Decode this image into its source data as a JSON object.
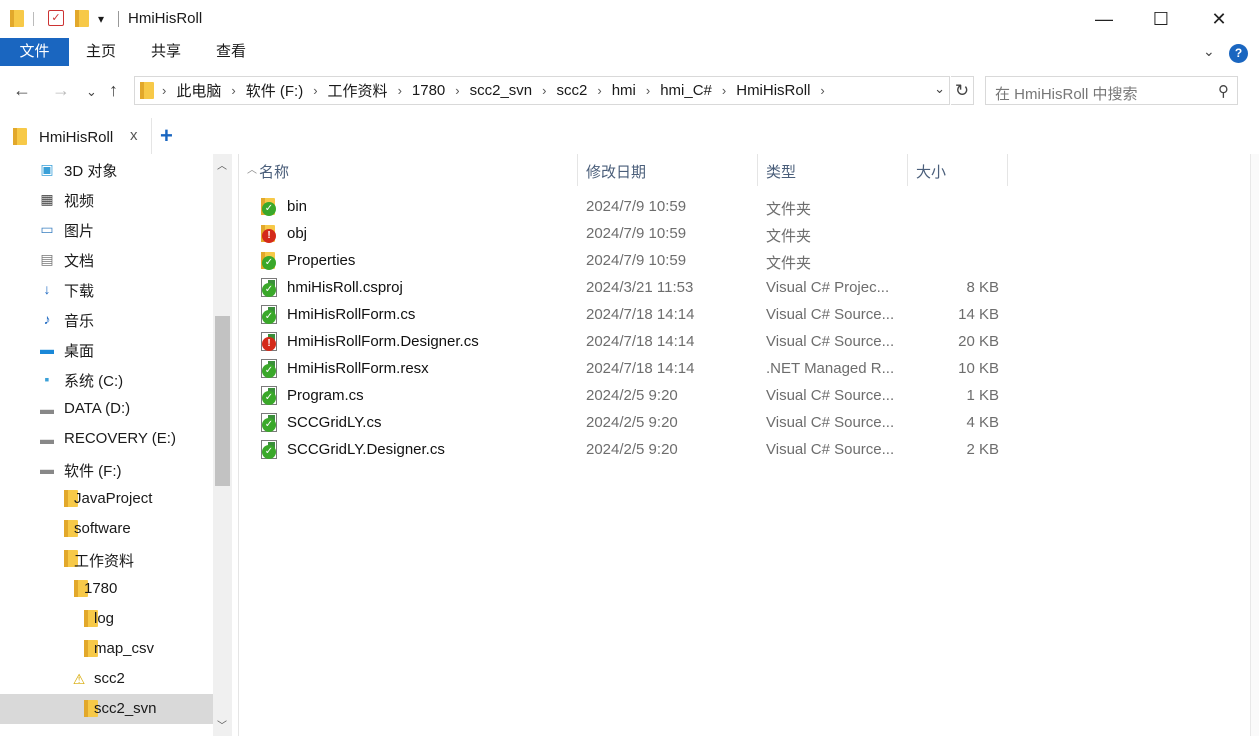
{
  "window": {
    "title": "HmiHisRoll",
    "minimize": "—",
    "maximize": "☐",
    "close": "✕"
  },
  "quick_access": {
    "dropdown": "▾"
  },
  "ribbon": {
    "tabs": [
      "文件",
      "主页",
      "共享",
      "查看"
    ],
    "expand": "⌄",
    "help": "?"
  },
  "nav": {
    "back": "←",
    "forward": "→",
    "recent": "⌄",
    "up": "↑",
    "breadcrumbs": [
      "此电脑",
      "软件 (F:)",
      "工作资料",
      "1780",
      "scc2_svn",
      "scc2",
      "hmi",
      "hmi_C#",
      "HmiHisRoll"
    ],
    "crumb_separator": "›",
    "dropdown": "⌄",
    "refresh": "↻"
  },
  "search": {
    "placeholder": "在 HmiHisRoll 中搜索",
    "icon": "⚲"
  },
  "tabs": {
    "current": "HmiHisRoll",
    "close": "x",
    "add": "+"
  },
  "sidebar": {
    "items": [
      {
        "label": "3D 对象",
        "icon": "cube-3d-icon"
      },
      {
        "label": "视频",
        "icon": "video-icon"
      },
      {
        "label": "图片",
        "icon": "picture-icon"
      },
      {
        "label": "文档",
        "icon": "document-icon"
      },
      {
        "label": "下载",
        "icon": "download-icon"
      },
      {
        "label": "音乐",
        "icon": "music-icon"
      },
      {
        "label": "桌面",
        "icon": "desktop-icon"
      },
      {
        "label": "系统 (C:)",
        "icon": "windows-drive-icon"
      },
      {
        "label": "DATA (D:)",
        "icon": "drive-icon"
      },
      {
        "label": "RECOVERY (E:)",
        "icon": "drive-icon"
      },
      {
        "label": "软件 (F:)",
        "icon": "drive-icon"
      },
      {
        "label": "JavaProject",
        "icon": "folder-icon"
      },
      {
        "label": "software",
        "icon": "folder-icon"
      },
      {
        "label": "工作资料",
        "icon": "folder-icon"
      },
      {
        "label": "1780",
        "icon": "folder-icon"
      },
      {
        "label": "log",
        "icon": "folder-icon"
      },
      {
        "label": "map_csv",
        "icon": "folder-icon"
      },
      {
        "label": "scc2",
        "icon": "folder-warning-icon"
      },
      {
        "label": "scc2_svn",
        "icon": "folder-icon",
        "selected": true
      }
    ]
  },
  "columns": {
    "name": "名称",
    "date": "修改日期",
    "type": "类型",
    "size": "大小"
  },
  "files": [
    {
      "name": "bin",
      "date": "2024/7/9 10:59",
      "type": "文件夹",
      "size": "",
      "kind": "folder",
      "status": "ok"
    },
    {
      "name": "obj",
      "date": "2024/7/9 10:59",
      "type": "文件夹",
      "size": "",
      "kind": "folder",
      "status": "err"
    },
    {
      "name": "Properties",
      "date": "2024/7/9 10:59",
      "type": "文件夹",
      "size": "",
      "kind": "folder",
      "status": "ok"
    },
    {
      "name": "hmiHisRoll.csproj",
      "date": "2024/3/21 11:53",
      "type": "Visual C# Projec...",
      "size": "8 KB",
      "kind": "file",
      "status": "ok"
    },
    {
      "name": "HmiHisRollForm.cs",
      "date": "2024/7/18 14:14",
      "type": "Visual C# Source...",
      "size": "14 KB",
      "kind": "file",
      "status": "ok"
    },
    {
      "name": "HmiHisRollForm.Designer.cs",
      "date": "2024/7/18 14:14",
      "type": "Visual C# Source...",
      "size": "20 KB",
      "kind": "file",
      "status": "err"
    },
    {
      "name": "HmiHisRollForm.resx",
      "date": "2024/7/18 14:14",
      "type": ".NET Managed R...",
      "size": "10 KB",
      "kind": "file",
      "status": "ok"
    },
    {
      "name": "Program.cs",
      "date": "2024/2/5 9:20",
      "type": "Visual C# Source...",
      "size": "1 KB",
      "kind": "file",
      "status": "ok"
    },
    {
      "name": "SCCGridLY.cs",
      "date": "2024/2/5 9:20",
      "type": "Visual C# Source...",
      "size": "4 KB",
      "kind": "file",
      "status": "ok"
    },
    {
      "name": "SCCGridLY.Designer.cs",
      "date": "2024/2/5 9:20",
      "type": "Visual C# Source...",
      "size": "2 KB",
      "kind": "file",
      "status": "ok"
    }
  ],
  "colors": {
    "accent": "#1a66c0",
    "ok": "#3aa82a",
    "err": "#d42a1a",
    "folder": "#f7c948"
  }
}
